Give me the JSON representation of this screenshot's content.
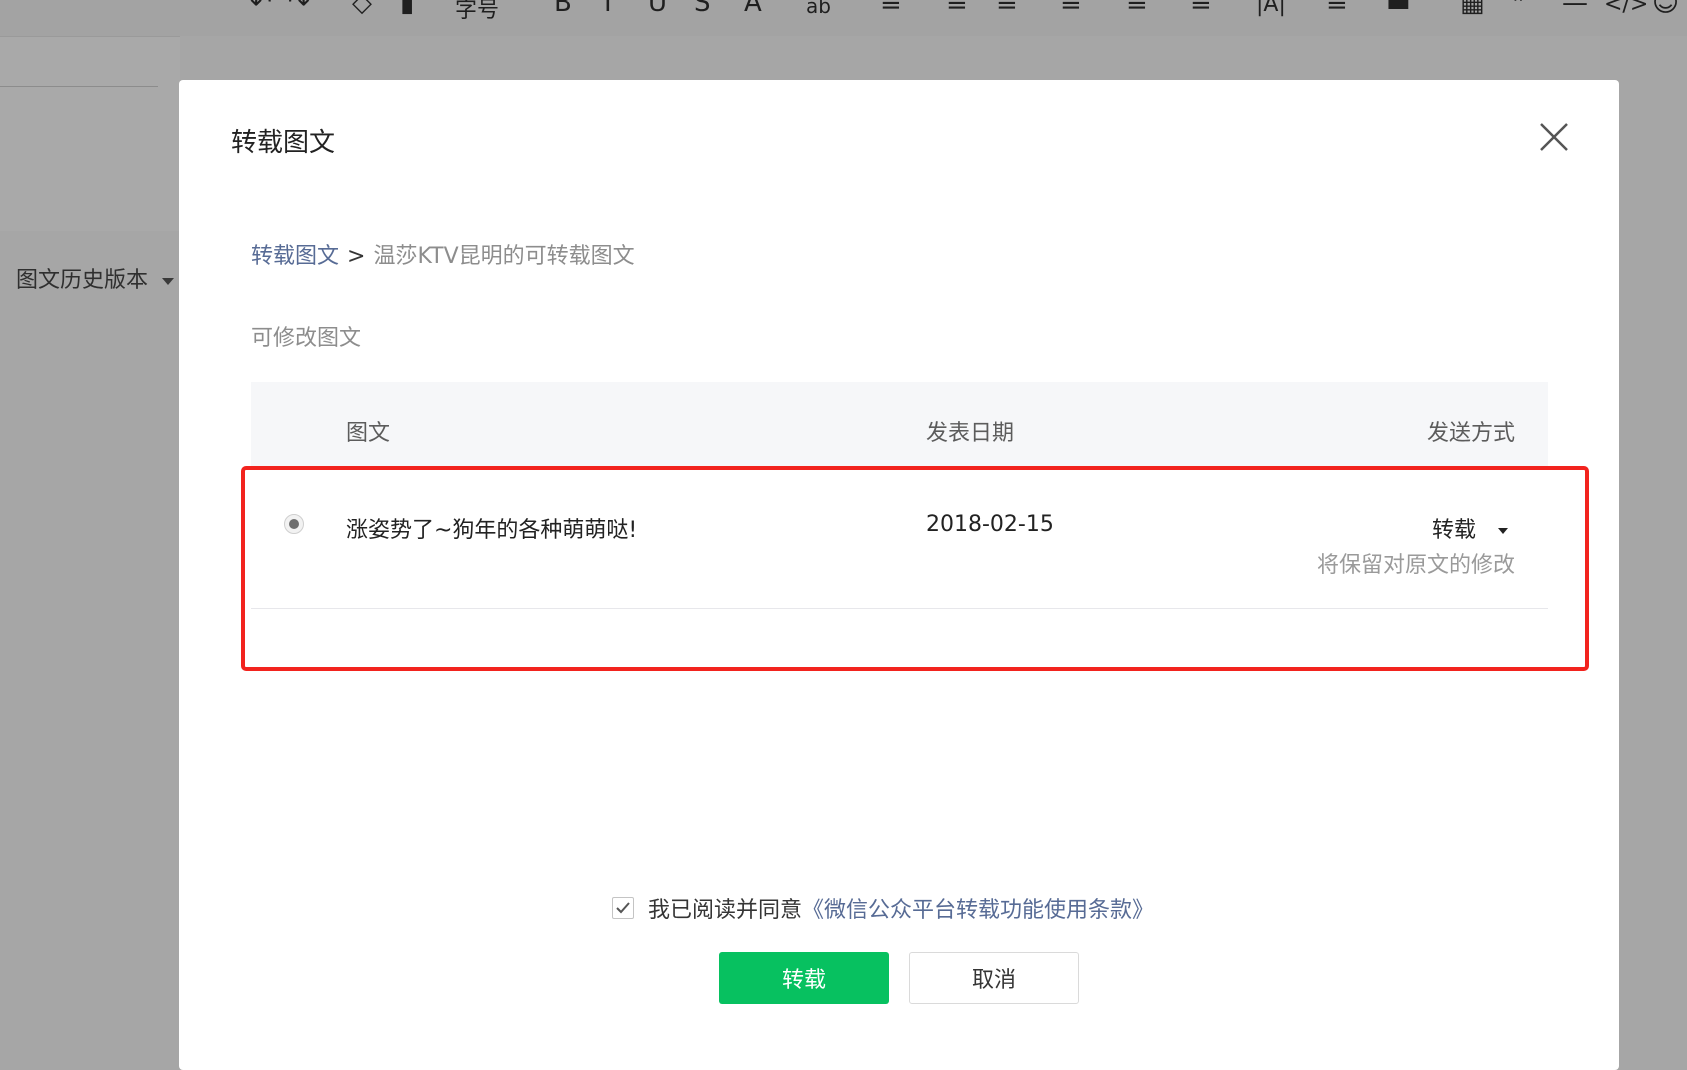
{
  "background": {
    "toolbar_glyphs": [
      "↶",
      "↷",
      "◇",
      "▮",
      "字号",
      "B",
      "I",
      "U",
      "S",
      "A",
      "ab",
      "≡",
      "≡",
      "≡",
      "≡",
      "≡",
      "≡",
      "|A|",
      "≡",
      "▬",
      "▦",
      "❞",
      "—",
      "</>",
      "☺"
    ],
    "history_label": "图文历史版本"
  },
  "dialog": {
    "title": "转载图文",
    "breadcrumb": {
      "link": "转载图文",
      "separator": ">",
      "current": "温莎KTV昆明的可转载图文"
    },
    "section_label": "可修改图文",
    "table": {
      "headers": {
        "title": "图文",
        "date": "发表日期",
        "send": "发送方式"
      },
      "rows": [
        {
          "title": "涨姿势了~狗年的各种萌萌哒!",
          "date": "2018-02-15",
          "send_method": "转载",
          "send_note": "将保留对原文的修改"
        }
      ]
    },
    "agreement": {
      "text": "我已阅读并同意",
      "link": "《微信公众平台转载功能使用条款》",
      "checked": true
    },
    "buttons": {
      "confirm": "转载",
      "cancel": "取消"
    },
    "colors": {
      "primary": "#07c160",
      "link": "#576b95",
      "highlight": "#f2231e"
    }
  }
}
